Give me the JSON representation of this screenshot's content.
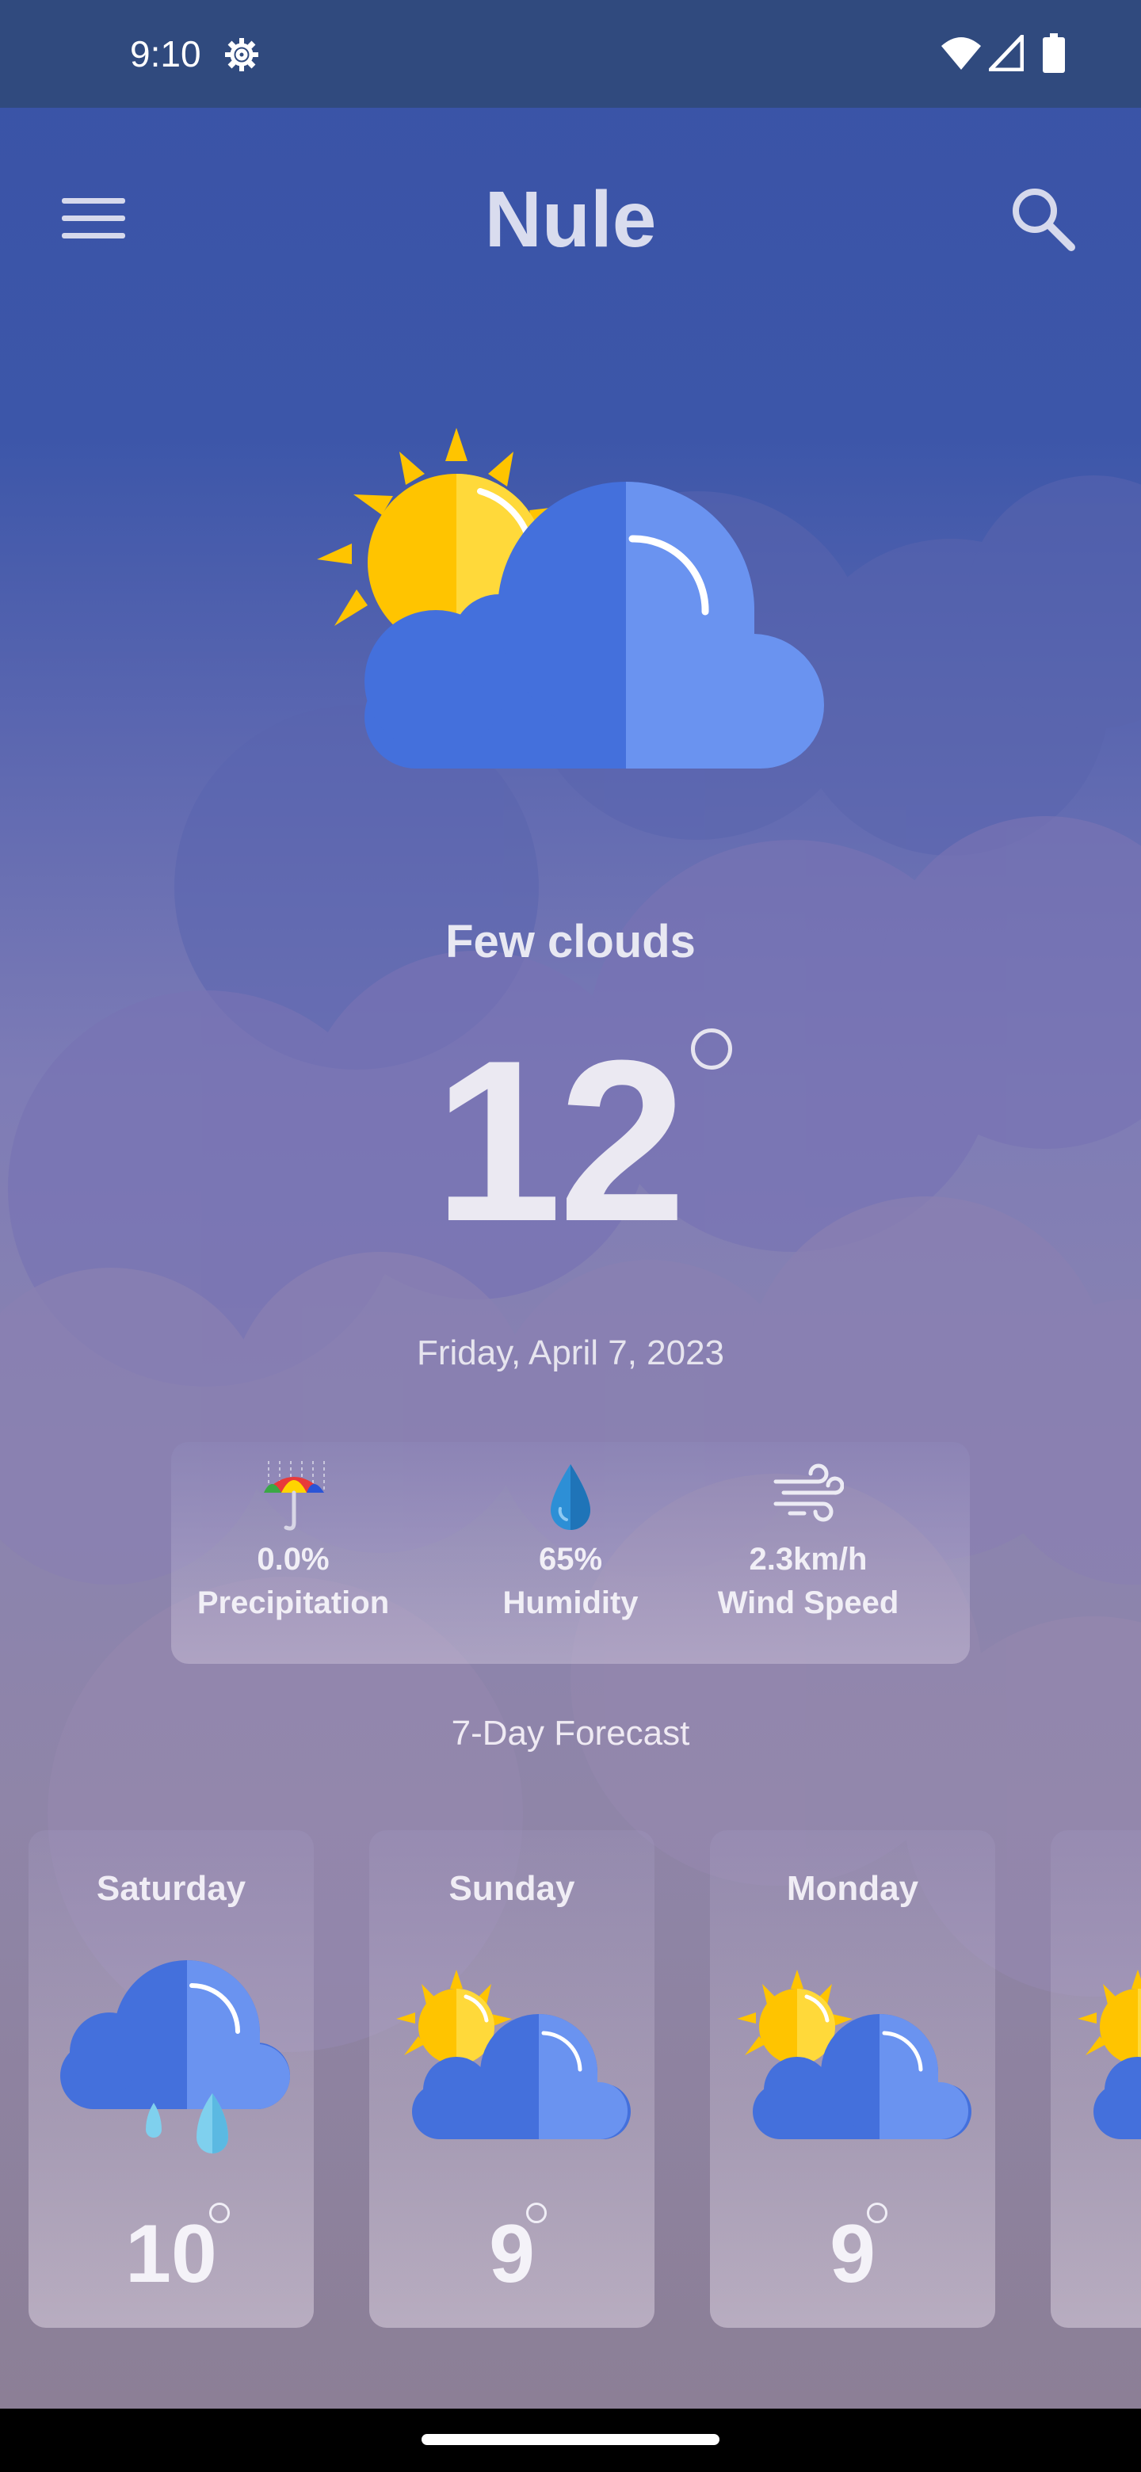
{
  "status_bar": {
    "time": "9:10",
    "icons": [
      "gear-icon",
      "wifi-icon",
      "signal-icon",
      "battery-icon"
    ]
  },
  "app_bar": {
    "title": "Nule",
    "menu_icon": "hamburger-menu-icon",
    "search_icon": "search-icon"
  },
  "current": {
    "icon": "sun-behind-cloud-icon",
    "condition": "Few clouds",
    "temperature": "12",
    "date": "Friday, April 7, 2023"
  },
  "stats": [
    {
      "icon": "umbrella-rain-icon",
      "value": "0.0%",
      "label": "Precipitation"
    },
    {
      "icon": "water-drop-icon",
      "value": "65%",
      "label": "Humidity"
    },
    {
      "icon": "wind-icon",
      "value": "2.3km/h",
      "label": "Wind Speed"
    }
  ],
  "forecast": {
    "heading": "7-Day Forecast",
    "days": [
      {
        "day": "Saturday",
        "icon": "rain-cloud-icon",
        "temp": "10"
      },
      {
        "day": "Sunday",
        "icon": "sun-behind-cloud-icon",
        "temp": "9"
      },
      {
        "day": "Monday",
        "icon": "sun-behind-cloud-icon",
        "temp": "9"
      },
      {
        "day": "T",
        "icon": "sun-behind-cloud-icon",
        "temp": ""
      }
    ]
  },
  "colors": {
    "status_bar": "#304a7e",
    "sky_top": "#3a53a6",
    "cloud_dark": "#4470dc",
    "cloud_light": "#6a93f0",
    "sun": "#ffc400"
  }
}
